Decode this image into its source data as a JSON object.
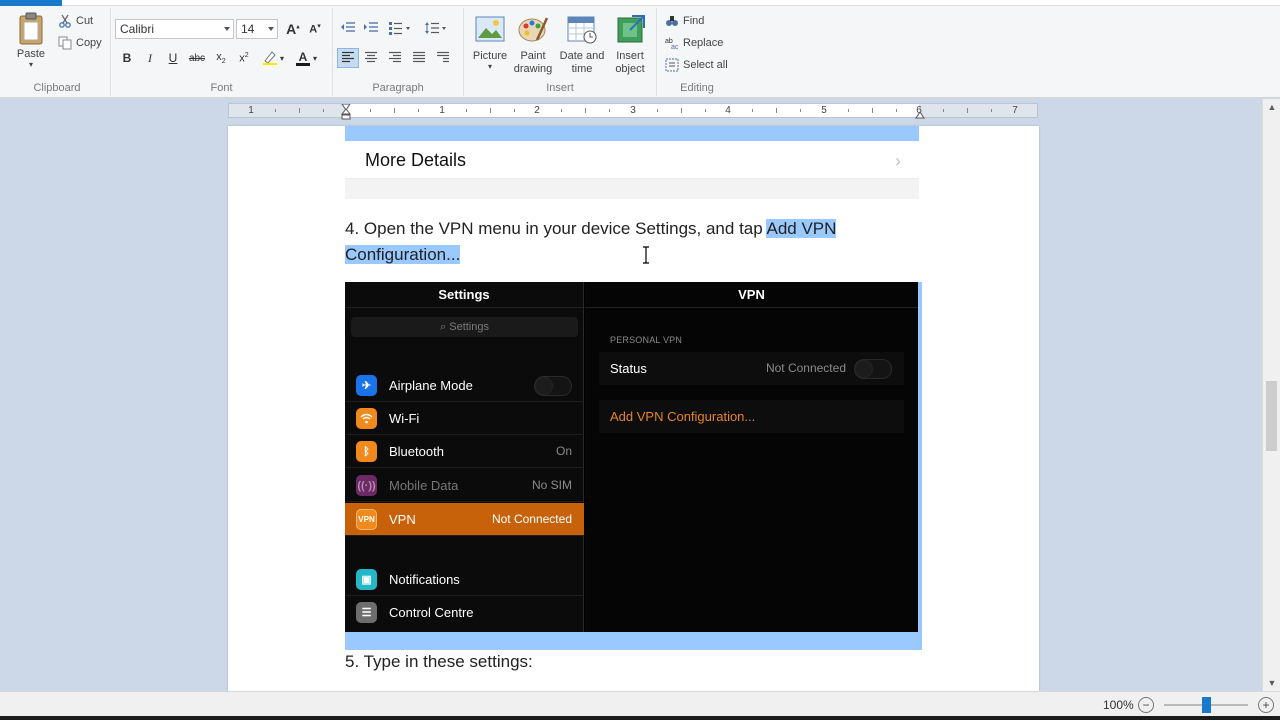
{
  "ribbon": {
    "clipboard": {
      "label": "Clipboard",
      "paste": "Paste",
      "cut": "Cut",
      "copy": "Copy"
    },
    "font": {
      "label": "Font",
      "family": "Calibri",
      "size": "14"
    },
    "paragraph": {
      "label": "Paragraph"
    },
    "insert": {
      "label": "Insert",
      "picture": "Picture",
      "paint_drawing": "Paint drawing",
      "date_time": "Date and time",
      "insert_object": "Insert object"
    },
    "editing": {
      "label": "Editing",
      "find": "Find",
      "replace": "Replace",
      "select_all": "Select all"
    }
  },
  "ruler": {
    "numbers": [
      "1",
      "1",
      "2",
      "3",
      "4",
      "5",
      "6",
      "7"
    ]
  },
  "document": {
    "more_details": "More Details",
    "step4_prefix": "4. Open the VPN menu in your device Settings, and tap ",
    "step4_highlight_1": "Add VPN",
    "step4_highlight_2": "Configuration...",
    "step5": "5. Type in these settings:"
  },
  "ios": {
    "settings_title": "Settings",
    "search_placeholder": "Settings",
    "vpn_title": "VPN",
    "rows": [
      {
        "label": "Airplane Mode",
        "value": "",
        "icon": "airplane-icon",
        "color": "#1a73e8"
      },
      {
        "label": "Wi-Fi",
        "value": "",
        "icon": "wifi-icon",
        "color": "#f08a1c"
      },
      {
        "label": "Bluetooth",
        "value": "On",
        "icon": "bluetooth-icon",
        "color": "#f08a1c"
      },
      {
        "label": "Mobile Data",
        "value": "No SIM",
        "icon": "antenna-icon",
        "color": "#6b2a63"
      },
      {
        "label": "VPN",
        "value": "Not Connected",
        "icon": "vpn-icon",
        "color": "#f08a1c"
      },
      {
        "label": "Notifications",
        "value": "",
        "icon": "notifications-icon",
        "color": "#23b8c8"
      },
      {
        "label": "Control Centre",
        "value": "",
        "icon": "control-centre-icon",
        "color": "#6d6d6d"
      }
    ],
    "personal_vpn": "PERSONAL VPN",
    "status_label": "Status",
    "status_value": "Not Connected",
    "add_vpn": "Add VPN Configuration..."
  },
  "status": {
    "zoom": "100%",
    "zoom_out": "−",
    "zoom_in": "+"
  },
  "colors": {
    "selection": "#99c9ff",
    "accent": "#1979ca",
    "ios_orange": "#c8620a"
  }
}
